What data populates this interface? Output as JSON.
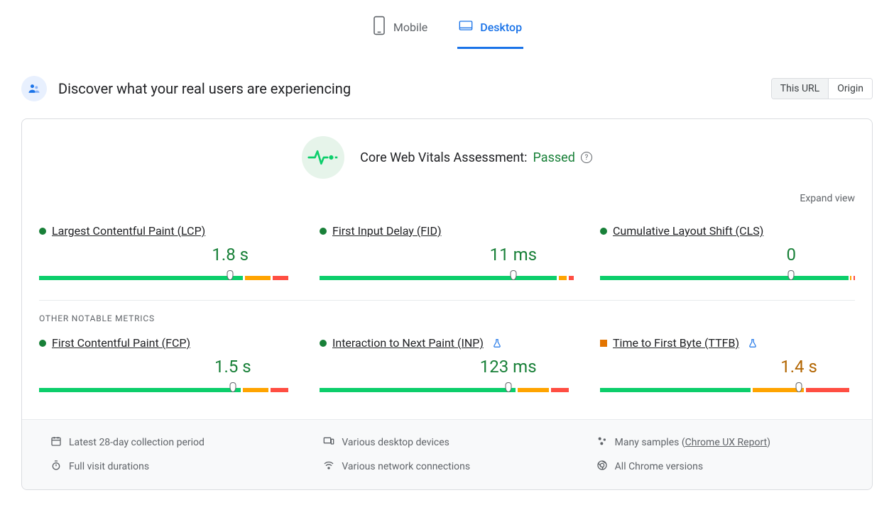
{
  "tabs": {
    "mobile": "Mobile",
    "desktop": "Desktop"
  },
  "header": {
    "title": "Discover what your real users are experiencing"
  },
  "scope": {
    "url": "This URL",
    "origin": "Origin"
  },
  "assessment": {
    "label": "Core Web Vitals Assessment:",
    "status": "Passed"
  },
  "expand": "Expand view",
  "metrics": {
    "lcp": {
      "name": "Largest Contentful Paint (LCP)",
      "value": "1.8 s",
      "marker": 75,
      "segs": [
        80,
        2,
        10,
        2,
        6
      ],
      "status": "good"
    },
    "fid": {
      "name": "First Input Delay (FID)",
      "value": "11 ms",
      "marker": 76,
      "segs": [
        93,
        1,
        3,
        1,
        2
      ],
      "status": "good"
    },
    "cls": {
      "name": "Cumulative Layout Shift (CLS)",
      "value": "0",
      "marker": 75,
      "segs": [
        98,
        0.5,
        0.5,
        0.5,
        0.5
      ],
      "status": "good"
    },
    "fcp": {
      "name": "First Contentful Paint (FCP)",
      "value": "1.5 s",
      "marker": 76,
      "segs": [
        79,
        2,
        10,
        2,
        7
      ],
      "status": "good"
    },
    "inp": {
      "name": "Interaction to Next Paint (INP)",
      "value": "123 ms",
      "marker": 74,
      "segs": [
        77,
        2,
        12,
        2,
        7
      ],
      "status": "good",
      "experimental": true
    },
    "ttfb": {
      "name": "Time to First Byte (TTFB)",
      "value": "1.4 s",
      "marker": 78,
      "segs": [
        59,
        2,
        20,
        2,
        17
      ],
      "status": "ni",
      "experimental": true
    }
  },
  "otherLabel": "OTHER NOTABLE METRICS",
  "info": {
    "period": "Latest 28-day collection period",
    "devices": "Various desktop devices",
    "samplesPrefix": "Many samples (",
    "samplesLink": "Chrome UX Report",
    "samplesSuffix": ")",
    "durations": "Full visit durations",
    "connections": "Various network connections",
    "chrome": "All Chrome versions"
  }
}
